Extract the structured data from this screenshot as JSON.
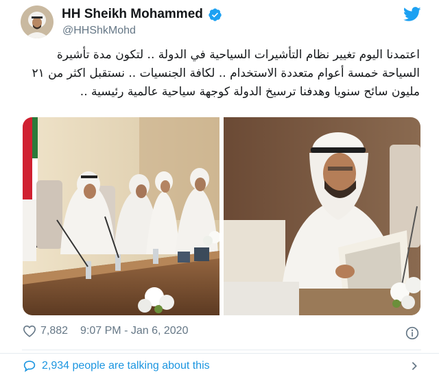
{
  "tweet": {
    "author": {
      "display_name": "HH Sheikh Mohammed",
      "handle": "@HHShkMohd",
      "verified": true
    },
    "text_lines": [
      "اعتمدنا اليوم تغيير نظام التأشيرات السياحية في الدولة .. لتكون مدة تأشيرة",
      "السياحة خمسة أعوام متعددة الاستخدام .. لكافة الجنسيات .. نستقبل اكثر من ٢١",
      "مليون سائح سنويا وهدفنا ترسيخ الدولة كوجهة سياحية عالمية رئيسية .."
    ],
    "likes": "7,882",
    "timestamp": "9:07 PM - Jan 6, 2020",
    "conversation": "2,934 people are talking about this"
  },
  "icons": {
    "verified": "verified-badge-icon",
    "bird": "twitter-bird-icon",
    "heart": "heart-icon",
    "info": "info-icon",
    "talk": "speech-bubble-icon",
    "chevron": "chevron-right-icon"
  },
  "colors": {
    "accent": "#1da1f2",
    "link": "#1b95e0",
    "muted": "#657786",
    "text": "#14171a",
    "border": "#e6ecf0"
  }
}
